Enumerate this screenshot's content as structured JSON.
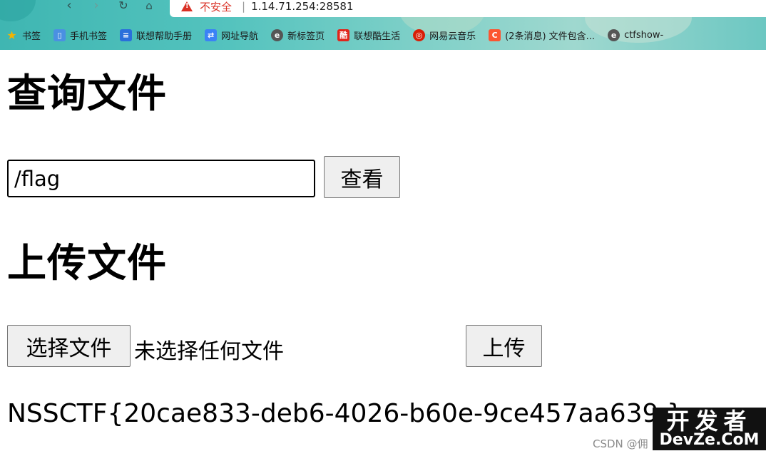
{
  "browser": {
    "security_label": "不安全",
    "address": "1.14.71.254:28581",
    "bookmarks": [
      {
        "label": "书签",
        "icon": "star-icon",
        "color": "#f4b400"
      },
      {
        "label": "手机书签",
        "icon": "phone-icon",
        "color": "#4a90e2"
      },
      {
        "label": "联想帮助手册",
        "icon": "book-icon",
        "color": "#2a6fdb"
      },
      {
        "label": "网址导航",
        "icon": "nav-icon",
        "color": "#3b82f6"
      },
      {
        "label": "新标签页",
        "icon": "edge-icon",
        "color": "#555555"
      },
      {
        "label": "联想酷生活",
        "icon": "lenovo-icon",
        "color": "#e1251b"
      },
      {
        "label": "网易云音乐",
        "icon": "netease-music-icon",
        "color": "#d81e06"
      },
      {
        "label": "(2条消息) 文件包含...",
        "icon": "csdn-icon",
        "color": "#fc5531"
      },
      {
        "label": "ctfshow-",
        "icon": "edge-icon",
        "color": "#555555"
      }
    ]
  },
  "page": {
    "query_heading": "查询文件",
    "query_input_value": "/flag",
    "view_button": "查看",
    "upload_heading": "上传文件",
    "choose_file_button": "选择文件",
    "no_file_text": "未选择任何文件",
    "upload_button": "上传",
    "result_text": "NSSCTF{20cae833-deb6-4026-b60e-9ce457aa639 }"
  },
  "watermark": {
    "csdn_text": "CSDN @佣",
    "logo_top": "开发者",
    "logo_bottom": "DevZe.CoM"
  }
}
